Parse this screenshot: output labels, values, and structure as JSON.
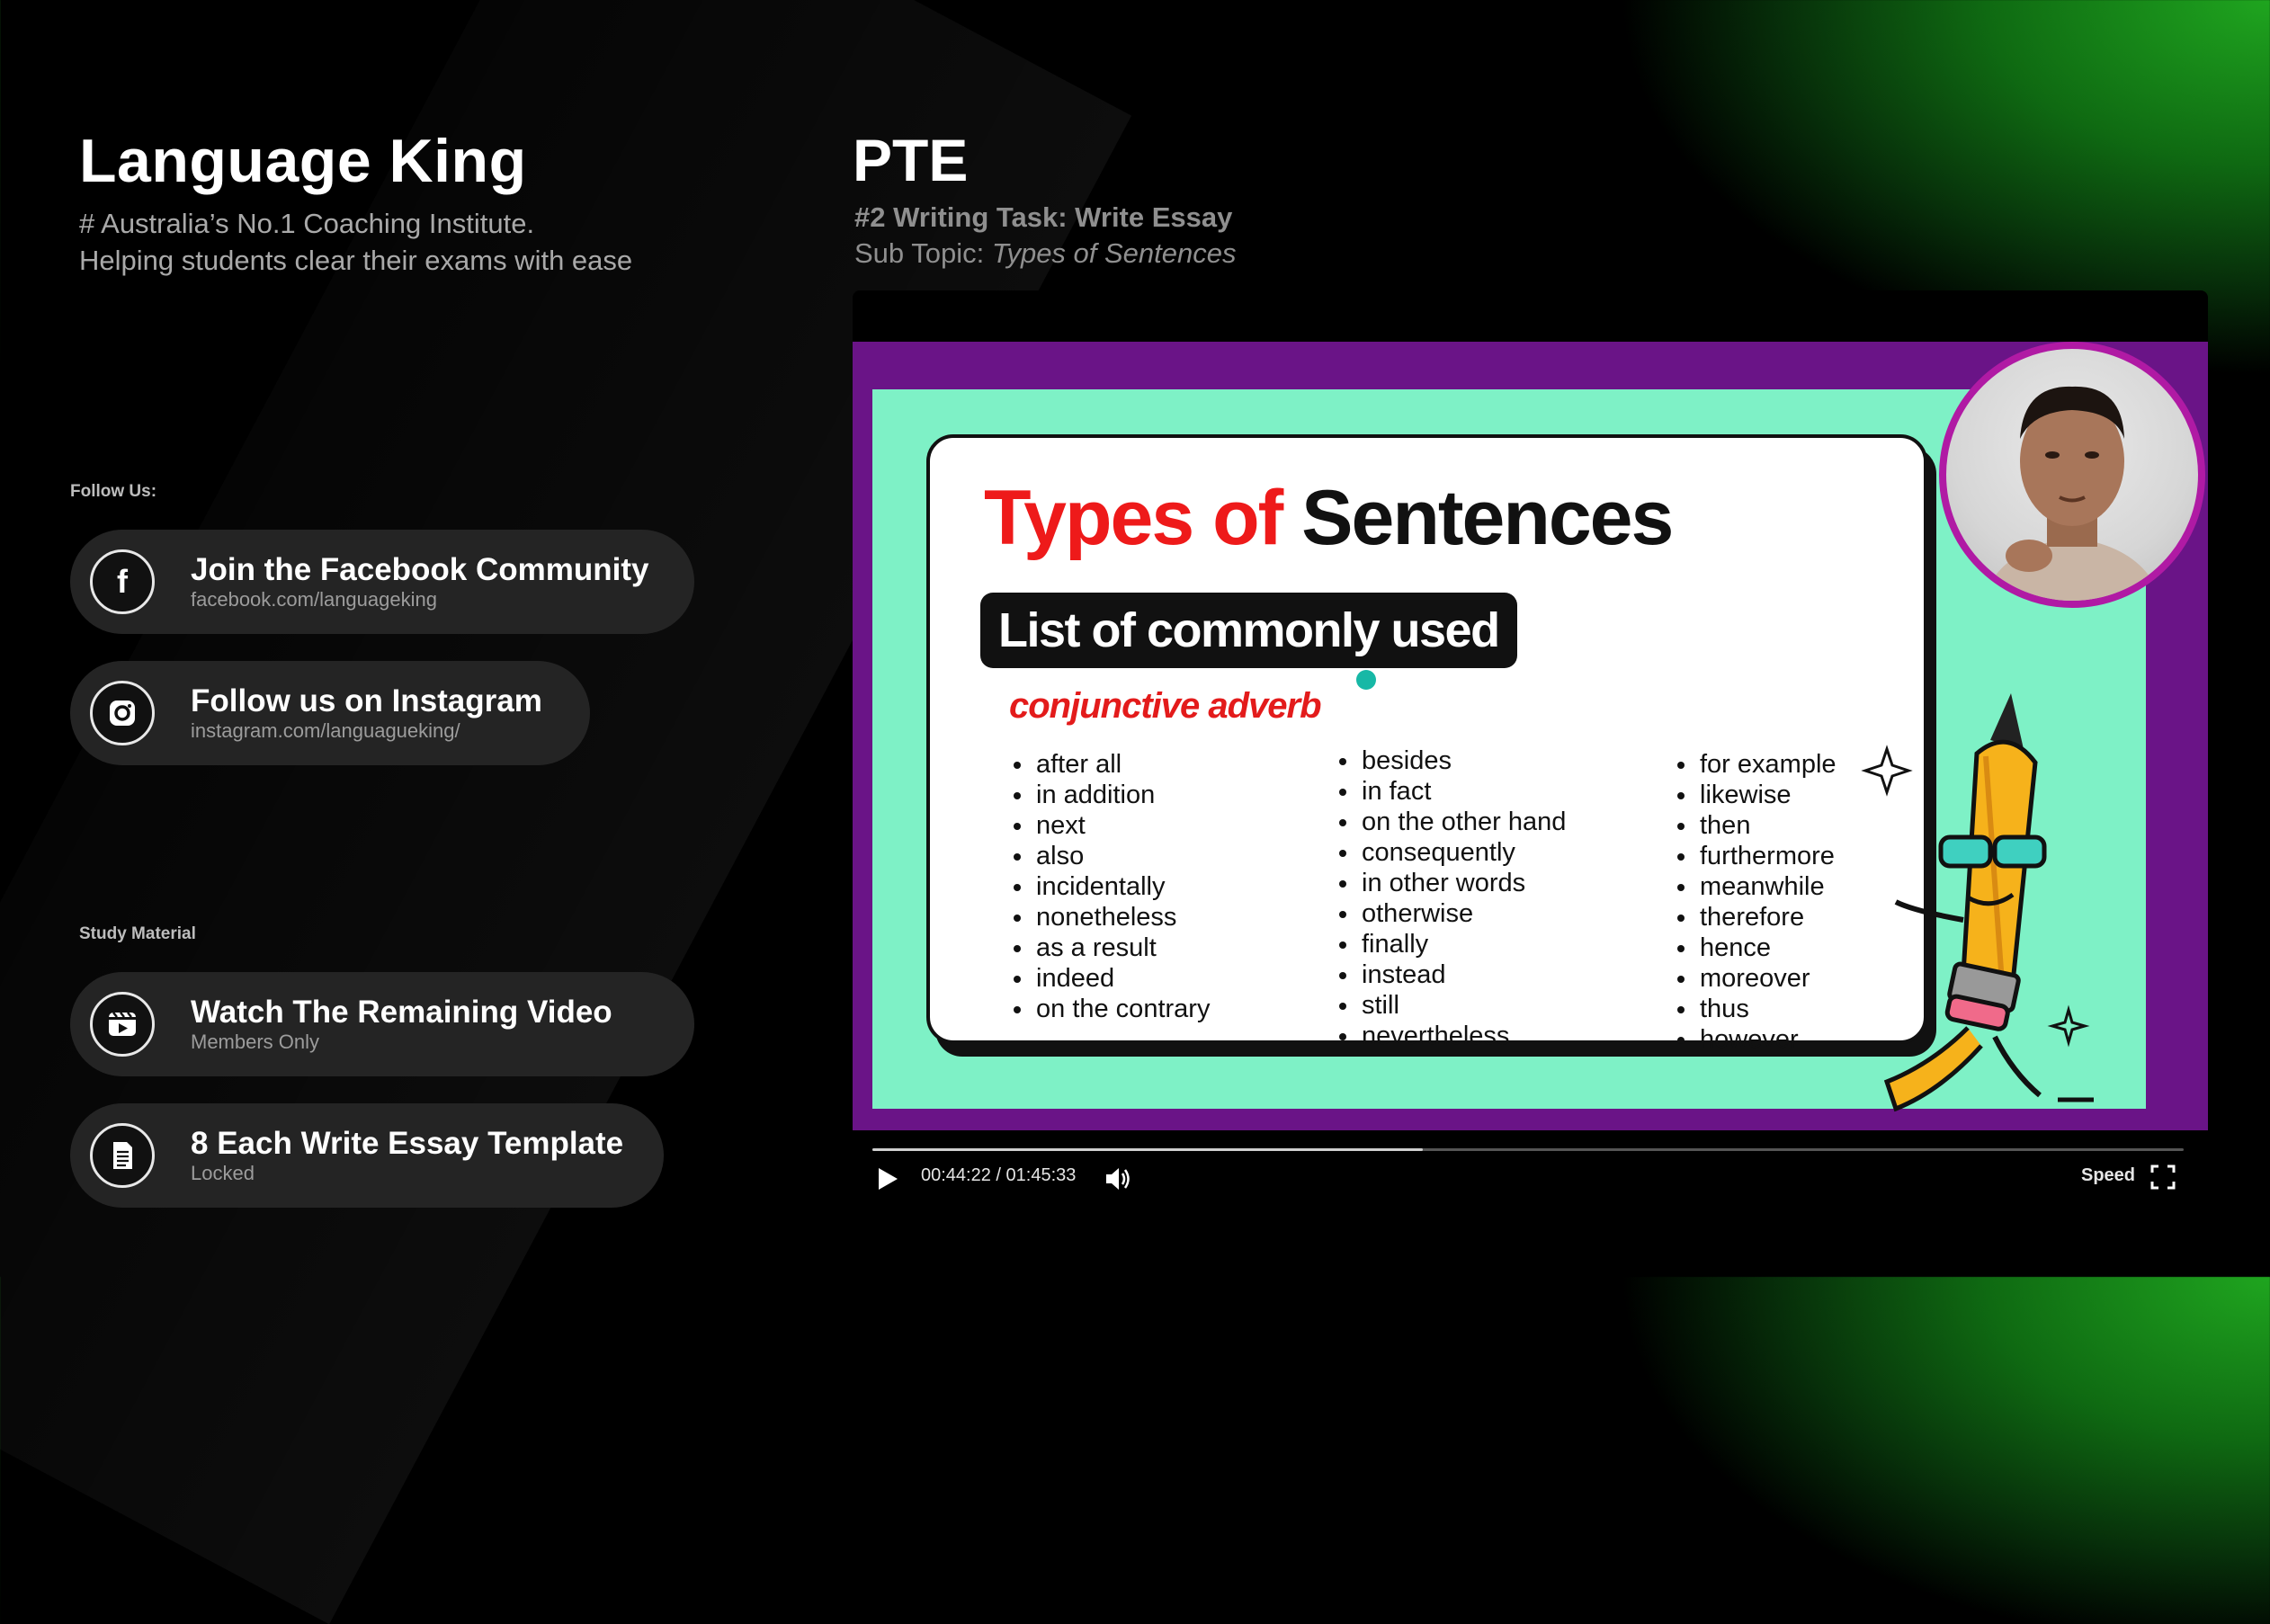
{
  "brand": {
    "title": "Language King",
    "tagline_1": "# Australia’s No.1 Coaching Institute.",
    "tagline_2": "Helping students clear their exams with ease"
  },
  "follow": {
    "label": "Follow Us:",
    "items": [
      {
        "title": "Join the Facebook Community",
        "subtitle": "facebook.com/languageking",
        "icon": "facebook-icon"
      },
      {
        "title": "Follow us on Instagram",
        "subtitle": "instagram.com/languagueking/",
        "icon": "instagram-icon"
      }
    ]
  },
  "study": {
    "label": "Study Material",
    "items": [
      {
        "title": "Watch The Remaining Video",
        "subtitle": "Members Only",
        "icon": "video-icon"
      },
      {
        "title": "8 Each Write Essay Template",
        "subtitle": "Locked",
        "icon": "document-icon"
      }
    ]
  },
  "lesson": {
    "course": "PTE",
    "task": "#2 Writing Task: Write Essay",
    "subtopic_label": "Sub Topic: ",
    "subtopic": "Types of Sentences"
  },
  "slide": {
    "title_red": "Types of",
    "title_black": " Sentences",
    "badge": "List of commonly used",
    "label": "conjunctive adverb",
    "col1": [
      "after all",
      "in addition",
      "next",
      "also",
      "incidentally",
      "nonetheless",
      "as a result",
      "indeed",
      "on the contrary"
    ],
    "col2": [
      "besides",
      "in fact",
      "on the other hand",
      "consequently",
      "in other words",
      "otherwise",
      "finally",
      "instead",
      "still",
      "nevertheless"
    ],
    "col3": [
      "for example",
      "likewise",
      "then",
      "furthermore",
      "meanwhile",
      "therefore",
      "hence",
      "moreover",
      "thus",
      "however"
    ]
  },
  "player": {
    "current_time": "00:44:22",
    "separator": " / ",
    "duration": "01:45:33",
    "progress_fraction": 0.42,
    "speed_label": "Speed",
    "play_icon": "play-icon",
    "volume_icon": "volume-icon",
    "fullscreen_icon": "fullscreen-icon"
  },
  "colors": {
    "accent_green": "#1fa51f",
    "slide_purple": "#6a1487",
    "slide_mint": "#7ef1c6",
    "title_red": "#ee1a1a"
  }
}
